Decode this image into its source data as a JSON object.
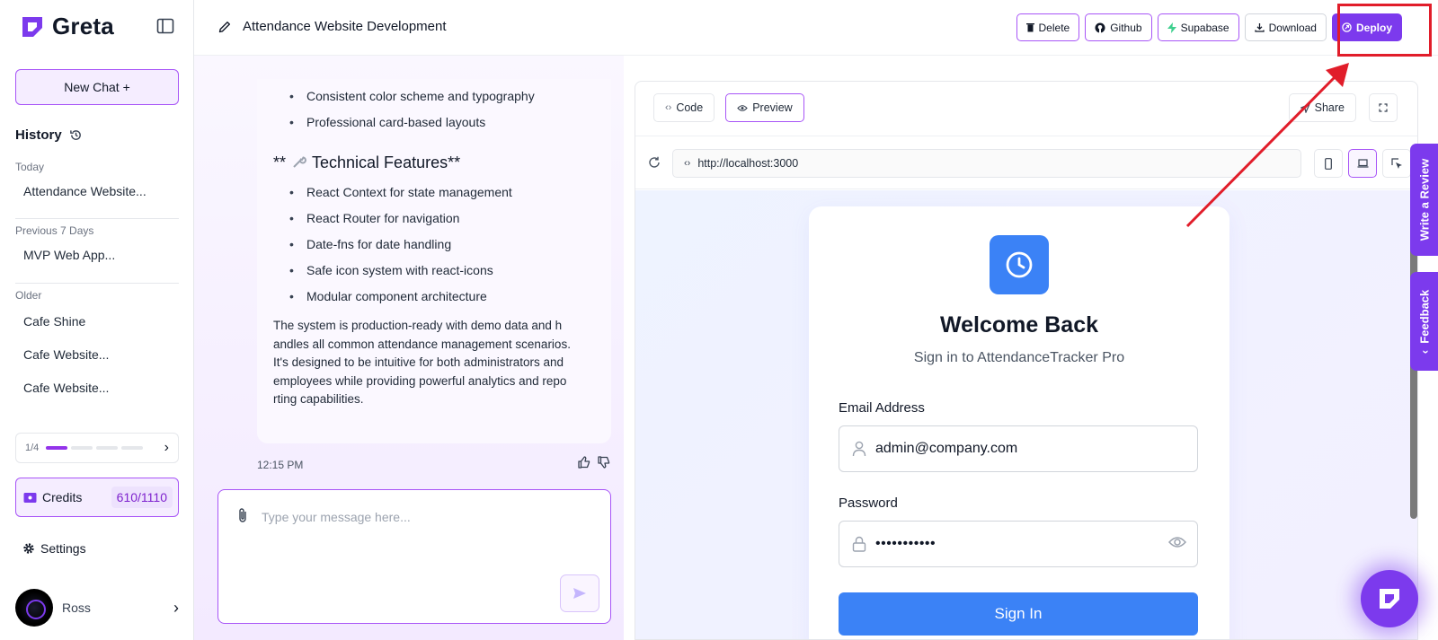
{
  "app": {
    "name": "Greta"
  },
  "sidebar": {
    "new_chat_label": "New Chat +",
    "history_title": "History",
    "groups": [
      {
        "label": "Today",
        "items": [
          "Attendance Website..."
        ]
      },
      {
        "label": "Previous 7 Days",
        "items": [
          "MVP Web App..."
        ]
      },
      {
        "label": "Older",
        "items": [
          "Cafe Shine",
          "Cafe Website...",
          "Cafe Website..."
        ]
      }
    ],
    "pager": {
      "text": "1/4",
      "current": 1,
      "total": 4
    },
    "credits": {
      "label": "Credits",
      "value": "610/1110"
    },
    "settings_label": "Settings",
    "user_name": "Ross"
  },
  "topbar": {
    "project_title": "Attendance Website Development",
    "buttons": {
      "delete": "Delete",
      "github": "Github",
      "supabase": "Supabase",
      "download": "Download",
      "deploy": "Deploy"
    }
  },
  "chat": {
    "design_bullets": [
      "Consistent color scheme and typography",
      "Professional card-based layouts"
    ],
    "tech_heading_prefix": "** ",
    "tech_heading": "Technical Features**",
    "tech_bullets": [
      "React Context for state management",
      "React Router for navigation",
      "Date-fns for date handling",
      "Safe icon system with react-icons",
      "Modular component architecture"
    ],
    "summary_lines": [
      "The system is production-ready with demo data and h",
      "andles all common attendance management scenarios.",
      "It's designed to be intuitive for both administrators and",
      "employees while providing powerful analytics and repo",
      "rting capabilities."
    ],
    "timestamp": "12:15 PM",
    "input_placeholder": "Type your message here..."
  },
  "preview": {
    "tabs": {
      "code": "Code",
      "preview": "Preview"
    },
    "share_label": "Share",
    "url": "http://localhost:3000",
    "login": {
      "title": "Welcome Back",
      "subtitle": "Sign in to AttendanceTracker Pro",
      "email_label": "Email Address",
      "email_value": "admin@company.com",
      "password_label": "Password",
      "password_value": "•••••••••••",
      "submit_label": "Sign In"
    }
  },
  "widgets": {
    "review_tab": "Write a Review",
    "feedback_tab": "Feedback"
  },
  "colors": {
    "accent": "#7c3aed",
    "accent_border": "#a855f7",
    "login_blue": "#3b82f6",
    "annotation_red": "#e11d2a"
  },
  "icons": [
    "greta-logo-icon",
    "sidebar-toggle-icon",
    "history-icon",
    "ticket-icon",
    "gear-icon",
    "chevron-right-icon",
    "pencil-icon",
    "trash-icon",
    "github-icon",
    "bolt-icon",
    "download-icon",
    "rocket-icon",
    "code-icon",
    "eye-icon",
    "share-icon",
    "expand-icon",
    "refresh-icon",
    "mobile-icon",
    "laptop-icon",
    "cursor-select-icon",
    "clock-icon",
    "user-icon",
    "lock-icon",
    "paperclip-icon",
    "send-icon",
    "thumbs-up-icon",
    "thumbs-down-icon",
    "wrench-icon"
  ]
}
